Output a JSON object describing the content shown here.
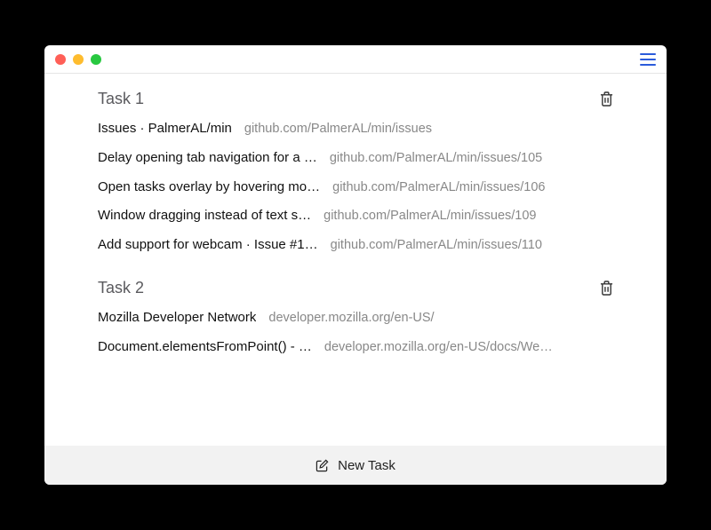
{
  "tasks": [
    {
      "title": "Task 1",
      "tabs": [
        {
          "title": "Issues · PalmerAL/min",
          "url": "github.com/PalmerAL/min/issues"
        },
        {
          "title": "Delay opening tab navigation for a …",
          "url": "github.com/PalmerAL/min/issues/105"
        },
        {
          "title": "Open tasks overlay by hovering mo…",
          "url": "github.com/PalmerAL/min/issues/106"
        },
        {
          "title": "Window dragging instead of text s…",
          "url": "github.com/PalmerAL/min/issues/109"
        },
        {
          "title": "Add support for webcam · Issue #1…",
          "url": "github.com/PalmerAL/min/issues/110"
        }
      ]
    },
    {
      "title": "Task 2",
      "tabs": [
        {
          "title": "Mozilla Developer Network",
          "url": "developer.mozilla.org/en-US/"
        },
        {
          "title": "Document.elementsFromPoint() - …",
          "url": "developer.mozilla.org/en-US/docs/We…"
        }
      ]
    }
  ],
  "newTaskLabel": "New Task"
}
